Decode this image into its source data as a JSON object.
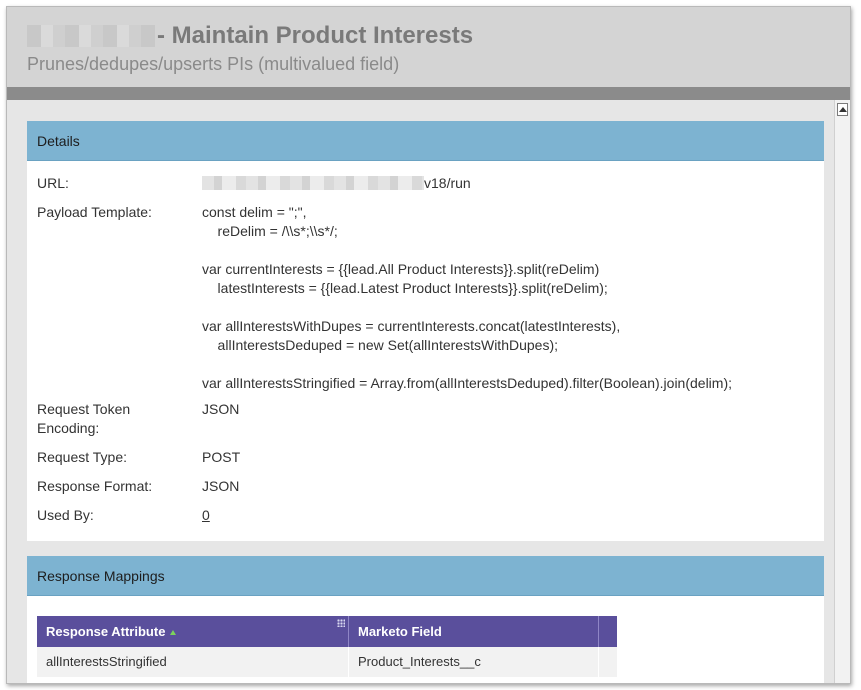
{
  "header": {
    "title": "- Maintain Product Interests",
    "subtitle": "Prunes/dedupes/upserts PIs (multivalued field)"
  },
  "details": {
    "section_title": "Details",
    "url": {
      "label": "URL:",
      "value_suffix": "v18/run"
    },
    "payload_template": {
      "label": "Payload Template:",
      "lines": [
        "const delim = \";\",",
        "    reDelim = /\\\\s*;\\\\s*/;",
        "",
        "var currentInterests = {{lead.All Product Interests}}.split(reDelim)",
        "    latestInterests = {{lead.Latest Product Interests}}.split(reDelim);",
        "",
        "var allInterestsWithDupes = currentInterests.concat(latestInterests),",
        "    allInterestsDeduped = new Set(allInterestsWithDupes);",
        "",
        "var allInterestsStringified = Array.from(allInterestsDeduped).filter(Boolean).join(delim);"
      ]
    },
    "request_token_encoding": {
      "label_line1": "Request Token",
      "label_line2": "Encoding:",
      "value": "JSON"
    },
    "request_type": {
      "label": "Request Type:",
      "value": "POST"
    },
    "response_format": {
      "label": "Response Format:",
      "value": "JSON"
    },
    "used_by": {
      "label": "Used By:",
      "value": "0"
    }
  },
  "mappings": {
    "section_title": "Response Mappings",
    "columns": [
      "Response Attribute",
      "Marketo Field"
    ],
    "rows": [
      {
        "attribute": "allInterestsStringified",
        "field": "Product_Interests__c"
      }
    ]
  },
  "colors": {
    "panel_header": "#7db3d1",
    "grid_header": "#5a4f9c",
    "header_background": "#d4d4d4",
    "header_bar": "#8b8b8b"
  },
  "icons": {
    "sort": "sort-ascending-icon",
    "resize": "column-resize-grip-icon",
    "scroll": "scroll-up-arrow-icon"
  }
}
